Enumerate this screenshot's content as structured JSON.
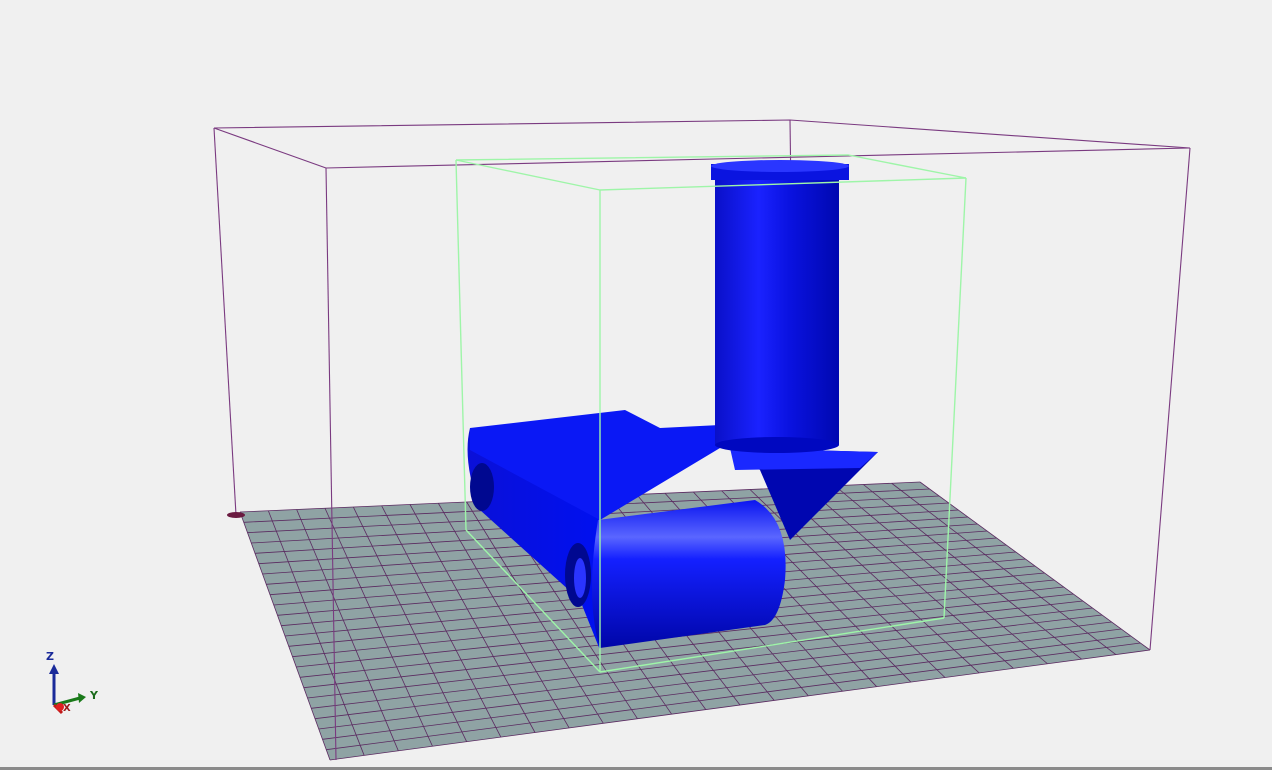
{
  "viewport": {
    "background": "#f0f0f0",
    "build_plate_color": "#8fa3a4",
    "grid_line_color": "#5a2a60",
    "build_volume_color": "#7a3a80",
    "bounding_box_color": "#9ef5a8",
    "model_color": "#0a10e8"
  },
  "axes": {
    "z_label": "Z",
    "y_label": "Y",
    "x_label": "X"
  },
  "icons": {
    "axis_triad": "axis-triad-icon"
  }
}
